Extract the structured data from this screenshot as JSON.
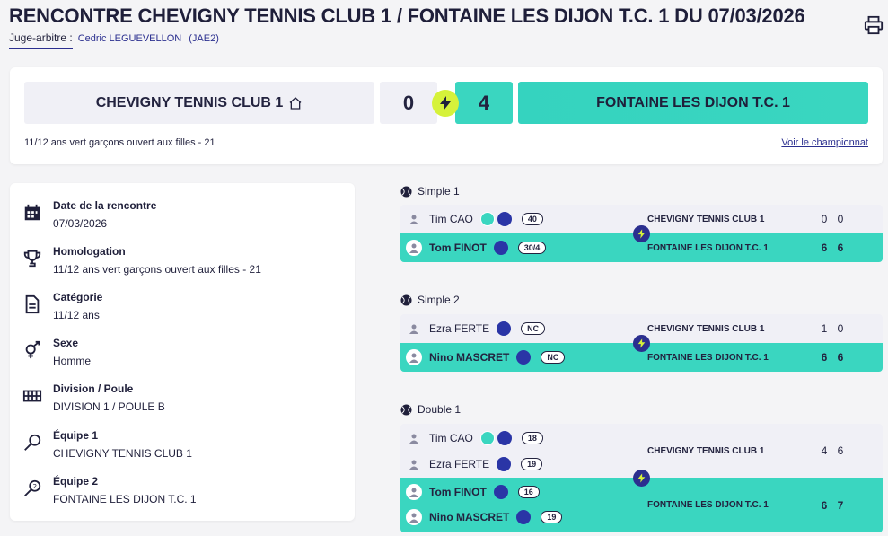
{
  "header": {
    "title": "RENCONTRE CHEVIGNY TENNIS CLUB 1 / FONTAINE LES DIJON T.C. 1 DU 07/03/2026",
    "referee_label": "Juge-arbitre :",
    "referee_name": "Cedric LEGUEVELLON",
    "referee_level": "(JAE2)"
  },
  "score": {
    "home_team": "CHEVIGNY TENNIS CLUB 1",
    "home_score": "0",
    "away_score": "4",
    "away_team": "FONTAINE LES DIJON T.C. 1",
    "competition": "11/12 ans vert garçons ouvert aux filles - 21",
    "championship_link": "Voir le championnat"
  },
  "info": {
    "date_label": "Date de la rencontre",
    "date_value": "07/03/2026",
    "homologation_label": "Homologation",
    "homologation_value": "11/12 ans vert garçons ouvert aux filles - 21",
    "category_label": "Catégorie",
    "category_value": "11/12 ans",
    "sex_label": "Sexe",
    "sex_value": "Homme",
    "division_label": "Division / Poule",
    "division_value": "DIVISION 1 / POULE B",
    "team1_label": "Équipe 1",
    "team1_value": "CHEVIGNY TENNIS CLUB 1",
    "team2_label": "Équipe 2",
    "team2_value": "FONTAINE LES DIJON T.C. 1"
  },
  "matches": {
    "simple1": {
      "title": "Simple 1",
      "home_player": "Tim CAO",
      "home_rank": "40",
      "home_club": "CHEVIGNY TENNIS CLUB 1",
      "home_s1": "0",
      "home_s2": "0",
      "away_player": "Tom FINOT",
      "away_rank": "30/4",
      "away_club": "FONTAINE LES DIJON T.C. 1",
      "away_s1": "6",
      "away_s2": "6"
    },
    "simple2": {
      "title": "Simple 2",
      "home_player": "Ezra FERTE",
      "home_rank": "NC",
      "home_club": "CHEVIGNY TENNIS CLUB 1",
      "home_s1": "1",
      "home_s2": "0",
      "away_player": "Nino MASCRET",
      "away_rank": "NC",
      "away_club": "FONTAINE LES DIJON T.C. 1",
      "away_s1": "6",
      "away_s2": "6"
    },
    "double1": {
      "title": "Double 1",
      "home_player1": "Tim CAO",
      "home_rank1": "18",
      "home_player2": "Ezra FERTE",
      "home_rank2": "19",
      "home_club": "CHEVIGNY TENNIS CLUB 1",
      "home_s1": "4",
      "home_s2": "6",
      "away_player1": "Tom FINOT",
      "away_rank1": "16",
      "away_player2": "Nino MASCRET",
      "away_rank2": "19",
      "away_club": "FONTAINE LES DIJON T.C. 1",
      "away_s1": "6",
      "away_s2": "7"
    }
  },
  "colors": {
    "accent_teal": "#3ad6c0",
    "navy": "#2b2f8f",
    "bolt_yellow": "#d6f23a",
    "light_row": "#f0f0f6"
  },
  "icons": [
    "print-icon",
    "home-icon",
    "bolt-icon",
    "calendar-icon",
    "trophy-icon",
    "document-icon",
    "gender-icon",
    "grid-icon",
    "racket-icon",
    "racket-2-icon",
    "tennis-ball-icon",
    "user-icon",
    "flag-icon"
  ]
}
